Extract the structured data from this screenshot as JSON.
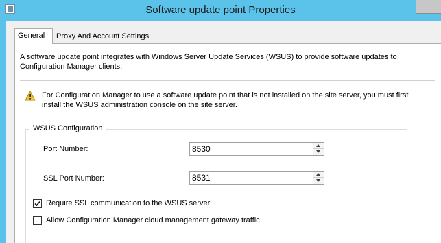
{
  "window": {
    "title": "Software update point Properties"
  },
  "tabs": [
    {
      "label": "General",
      "active": true
    },
    {
      "label": "Proxy And Account Settings",
      "active": false
    }
  ],
  "general": {
    "description": "A software update point integrates with Windows Server Update Services (WSUS) to provide software updates to Configuration Manager clients.",
    "warning_icon": "warning-icon",
    "warning_text": "For Configuration Manager to use a software update point that is not installed on the site server, you must first install the WSUS administration console on the site server.",
    "wsus_config": {
      "title": "WSUS Configuration",
      "port_label": "Port Number:",
      "port_value": "8530",
      "ssl_port_label": "SSL Port Number:",
      "ssl_port_value": "8531",
      "require_ssl_label": "Require SSL communication to the WSUS server",
      "require_ssl_checked": true,
      "cmg_label": "Allow Configuration Manager cloud management gateway traffic",
      "cmg_checked": false
    }
  },
  "colors": {
    "titlebar": "#5bc2ea",
    "client_bg": "#f0f0f0",
    "warning": "#f5c12e"
  }
}
